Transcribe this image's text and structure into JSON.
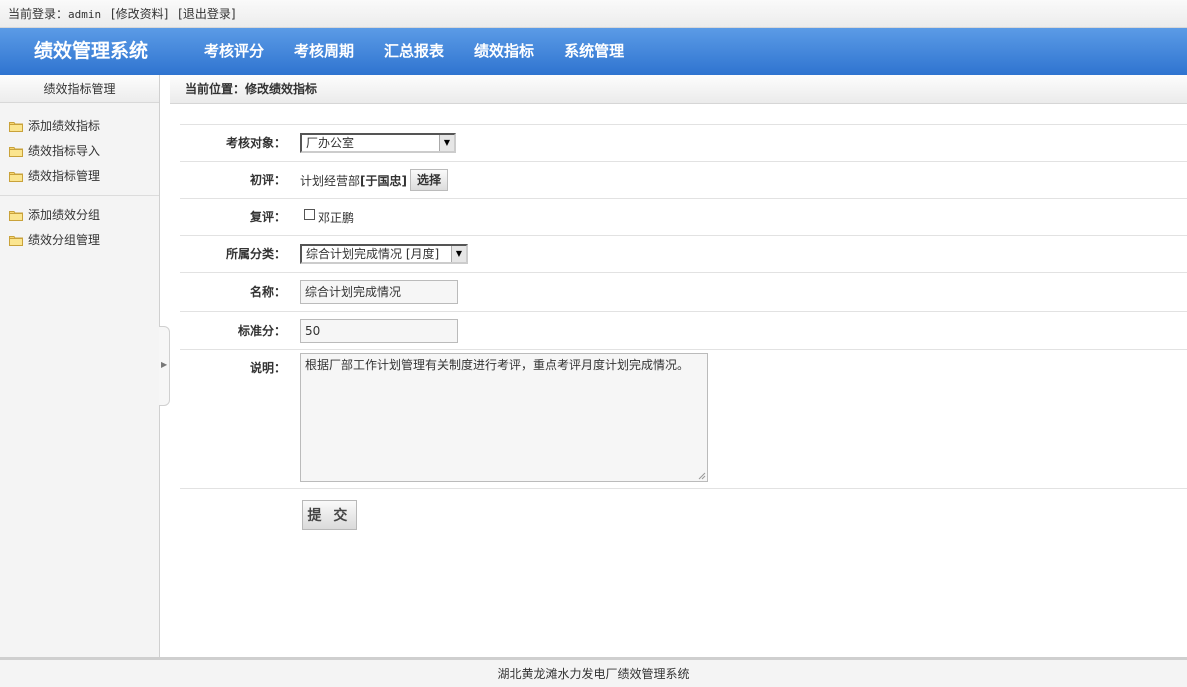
{
  "topbar": {
    "login_prefix": "当前登录：",
    "username": "admin",
    "edit_profile": "[修改资料]",
    "logout": "[退出登录]"
  },
  "header": {
    "title": "绩效管理系统",
    "nav": [
      "考核评分",
      "考核周期",
      "汇总报表",
      "绩效指标",
      "系统管理"
    ]
  },
  "sidebar": {
    "title": "绩效指标管理",
    "group1": [
      "添加绩效指标",
      "绩效指标导入",
      "绩效指标管理"
    ],
    "group2": [
      "添加绩效分组",
      "绩效分组管理"
    ],
    "icon": "folder-icon"
  },
  "breadcrumb": "当前位置：修改绩效指标",
  "form": {
    "target_label": "考核对象：",
    "target_value": "厂办公室",
    "first_review_label": "初评：",
    "first_review_dept": "计划经营部",
    "first_review_person": "[于国忠]",
    "select_button": "选择",
    "second_review_label": "复评：",
    "second_review_person": "邓正鹏",
    "category_label": "所属分类：",
    "category_value": "综合计划完成情况 [月度]",
    "name_label": "名称：",
    "name_value": "综合计划完成情况",
    "score_label": "标准分：",
    "score_value": "50",
    "desc_label": "说明：",
    "desc_value": "根据厂部工作计划管理有关制度进行考评，重点考评月度计划完成情况。",
    "submit": "提 交"
  },
  "footer": "湖北黄龙滩水力发电厂绩效管理系统"
}
